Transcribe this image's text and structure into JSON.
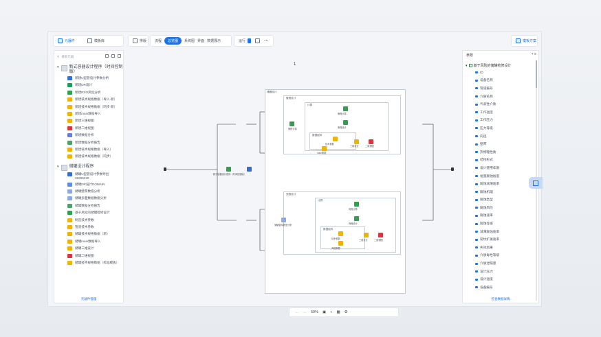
{
  "toolbar": {
    "tab_models": "元器件",
    "tab_templates": "模板库",
    "layout_btn": "排版",
    "view_modes": [
      "流程",
      "总览图",
      "系统图",
      "界面",
      "数据展示"
    ],
    "active_view": "总览图",
    "run_label": "运行",
    "publish_btn": "模板方案"
  },
  "left_panel": {
    "search_placeholder": "搜索元器",
    "groups": [
      {
        "title": "新式容器设计程序（时间控制版）",
        "items": [
          {
            "label": "新建U型管设计参数分析",
            "color": "#2f6fd6"
          },
          {
            "label": "新建DR设计",
            "color": "#1a9e60"
          },
          {
            "label": "新建RSO风险分析",
            "color": "#2fa04c"
          },
          {
            "label": "新建技术规格数据（导入-新）",
            "color": "#f0b400"
          },
          {
            "label": "新建技术规格数据（同步-新）",
            "color": "#f0b400"
          },
          {
            "label": "新建main数据导入",
            "color": "#f0b400"
          },
          {
            "label": "新建三维视图",
            "color": "#f0b400"
          },
          {
            "label": "新建二维视图",
            "color": "#d9363e"
          },
          {
            "label": "新建数据分析",
            "color": "#6a7bd6"
          },
          {
            "label": "新建数据分析报告",
            "color": "#4aa36a"
          },
          {
            "label": "新建技术规格数据（导入）",
            "color": "#f0b400"
          },
          {
            "label": "新建技术规格数据（同步）",
            "color": "#f0b400"
          }
        ]
      },
      {
        "title": "储罐设计程序",
        "items": [
          {
            "label": "储罐U型管设计参数导出 38256320",
            "color": "#2f6fd6",
            "tall": true
          },
          {
            "label": "储罐DR设计DOMAIN",
            "color": "#5a8fe0"
          },
          {
            "label": "储罐壁厚数值分析",
            "color": "#8aa8e6"
          },
          {
            "label": "储罐多面数据数据分析",
            "color": "#8aa8e6"
          },
          {
            "label": "储罐数据分析报告",
            "color": "#4aa36a"
          },
          {
            "label": "基于风险的储罐检修设计",
            "color": "#2fa04c"
          },
          {
            "label": "制造技术参数",
            "color": "#f0b400"
          },
          {
            "label": "管道技术参数",
            "color": "#f0b400"
          },
          {
            "label": "储罐技术规格数据（新）",
            "color": "#f0b400"
          },
          {
            "label": "储罐main数据导入",
            "color": "#f0b400"
          },
          {
            "label": "储罐三维设计",
            "color": "#f0b400"
          },
          {
            "label": "储罐二维视图",
            "color": "#d9363e"
          },
          {
            "label": "储罐技术规格数据（标准模板）",
            "color": "#f0b400",
            "tall": true
          }
        ]
      }
    ],
    "footer": "元器件管理"
  },
  "canvas": {
    "page_number": "1",
    "outer_frame": "储罐设计",
    "top_frame": "管程设计",
    "top_sub_frame": "计算",
    "top_inner_frame": "数据组件",
    "bottom_frame": "壳程设计",
    "bottom_sub_frame": "计算",
    "bottom_inner_frame": "数据组件",
    "node_labels": {
      "start": "新式容器设计程序（时间控制版）",
      "top_left": "管程计算",
      "top_n1": "管程计算",
      "top_n2": "管程设计",
      "top_n3": "技术参数",
      "top_n4": "main数据",
      "top_n5": "三维设计",
      "top_n6": "二维视图",
      "bottom_left": "储罐壁厚数值分析",
      "bottom_n1": "壳程计算",
      "bottom_n2": "壳程设计",
      "bottom_n3": "技术参数",
      "bottom_n4": "壳程数据",
      "bottom_n5": "三维设计",
      "bottom_n6": "二维视图"
    }
  },
  "zoom": {
    "value": "60%"
  },
  "right_panel": {
    "header": "参数",
    "root_label": "基于风险的储罐检修设计",
    "items": [
      "ID",
      "设备名称",
      "管道编号",
      "介质名称",
      "代表性介质",
      "工作温度",
      "工作压力",
      "压力等级",
      "内径",
      "壁厚",
      "热物理性质",
      "结构形式",
      "设计使用年限",
      "裕量腐蚀裕度",
      "腐蚀减薄速率",
      "腐蚀机理",
      "腐蚀类型",
      "腐蚀风险",
      "腐蚀速率",
      "腐蚀等级",
      "减薄腐蚀速率",
      "裂纹扩展速率",
      "失效后果",
      "介质毒性等级",
      "介质泄漏量",
      "设计压力",
      "设计温度",
      "设备编号"
    ],
    "footer": "检查数据详情"
  }
}
